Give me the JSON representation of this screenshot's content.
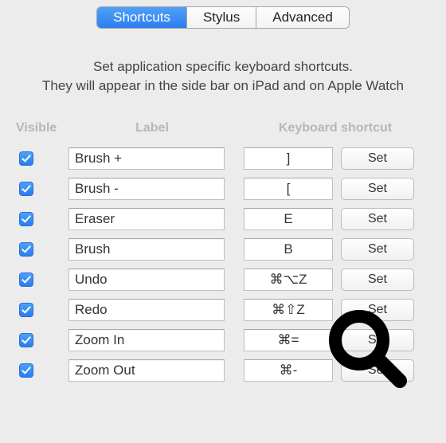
{
  "tabs": {
    "items": [
      {
        "label": "Shortcuts",
        "selected": true
      },
      {
        "label": "Stylus",
        "selected": false
      },
      {
        "label": "Advanced",
        "selected": false
      }
    ]
  },
  "description": {
    "line1": "Set application specific keyboard shortcuts.",
    "line2": "They will appear in the side bar on iPad and on Apple Watch"
  },
  "headers": {
    "visible": "Visible",
    "label": "Label",
    "shortcut": "Keyboard shortcut"
  },
  "rows": [
    {
      "visible": true,
      "label": "Brush +",
      "shortcut": "]",
      "set": "Set"
    },
    {
      "visible": true,
      "label": "Brush -",
      "shortcut": "[",
      "set": "Set"
    },
    {
      "visible": true,
      "label": "Eraser",
      "shortcut": "E",
      "set": "Set"
    },
    {
      "visible": true,
      "label": "Brush",
      "shortcut": "B",
      "set": "Set"
    },
    {
      "visible": true,
      "label": "Undo",
      "shortcut": "⌘⌥Z",
      "set": "Set"
    },
    {
      "visible": true,
      "label": "Redo",
      "shortcut": "⌘⇧Z",
      "set": "Set"
    },
    {
      "visible": true,
      "label": "Zoom In",
      "shortcut": "⌘=",
      "set": "Set"
    },
    {
      "visible": true,
      "label": "Zoom Out",
      "shortcut": "⌘-",
      "set": "Set"
    }
  ]
}
